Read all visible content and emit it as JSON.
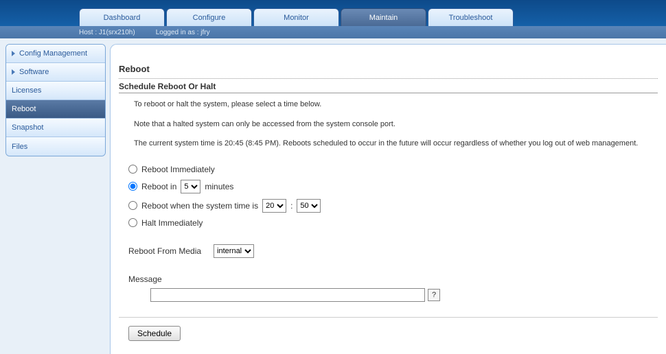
{
  "tabs": [
    {
      "label": "Dashboard",
      "active": false
    },
    {
      "label": "Configure",
      "active": false
    },
    {
      "label": "Monitor",
      "active": false
    },
    {
      "label": "Maintain",
      "active": true
    },
    {
      "label": "Troubleshoot",
      "active": false
    }
  ],
  "infobar": {
    "host": "Host : J1(srx210h)",
    "user": "Logged in as : jfry"
  },
  "sidebar": [
    {
      "label": "Config Management",
      "expandable": true,
      "active": false
    },
    {
      "label": "Software",
      "expandable": true,
      "active": false
    },
    {
      "label": "Licenses",
      "expandable": false,
      "active": false
    },
    {
      "label": "Reboot",
      "expandable": false,
      "active": true
    },
    {
      "label": "Snapshot",
      "expandable": false,
      "active": false
    },
    {
      "label": "Files",
      "expandable": false,
      "active": false
    }
  ],
  "page": {
    "title": "Reboot",
    "section_title": "Schedule Reboot Or Halt",
    "p1": "To reboot or halt the system, please select a time below.",
    "p2": "Note that a halted system can only be accessed from the system console port.",
    "p3": "The current system time is 20:45 (8:45 PM). Reboots scheduled to occur in the future will occur regardless of whether you log out of web management."
  },
  "options": {
    "opt_immediate": "Reboot Immediately",
    "opt_in_prefix": "Reboot in",
    "opt_in_minutes_value": "5",
    "opt_in_suffix": "minutes",
    "opt_when_prefix": "Reboot when the system time is",
    "opt_when_hour": "20",
    "opt_when_minute": "50",
    "opt_when_colon": ":",
    "opt_halt": "Halt Immediately",
    "selected_index": 1
  },
  "media": {
    "label": "Reboot From Media",
    "value": "internal"
  },
  "message": {
    "label": "Message",
    "value": "",
    "placeholder": "",
    "help": "?"
  },
  "buttons": {
    "schedule": "Schedule"
  }
}
